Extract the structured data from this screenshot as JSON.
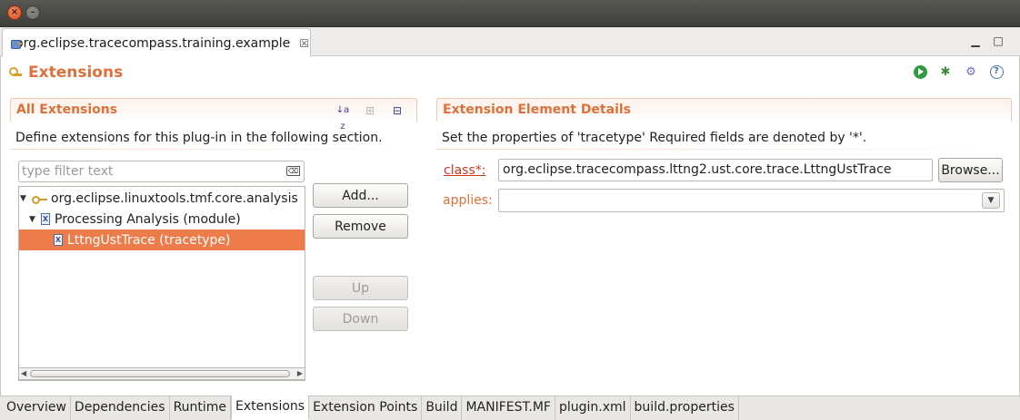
{
  "window": {
    "close_glyph": "×",
    "minimize_glyph": "–"
  },
  "editor_tab": {
    "title": "org.eclipse.tracecompass.training.example",
    "close_glyph": "☒",
    "minimize_glyph": "▁",
    "maximize_glyph": "□"
  },
  "page": {
    "title": "Extensions",
    "toolbar": {
      "run": "run-icon",
      "debug": "bug-icon",
      "manage": "plugin-settings-icon",
      "help_glyph": "?"
    }
  },
  "all_extensions": {
    "title": "All Extensions",
    "description": "Define extensions for this plug-in in the following section.",
    "filter_placeholder": "type filter text",
    "clear_glyph": "⌫",
    "tree": [
      {
        "label": "org.eclipse.linuxtools.tmf.core.analysis",
        "level": 0,
        "expanded": true,
        "icon": "key-icon"
      },
      {
        "label": "Processing Analysis (module)",
        "level": 1,
        "expanded": true,
        "icon": "x-icon"
      },
      {
        "label": "LttngUstTrace (tracetype)",
        "level": 2,
        "selected": true,
        "icon": "x-icon"
      }
    ],
    "buttons": {
      "add": "Add...",
      "remove": "Remove",
      "up": "Up",
      "down": "Down"
    },
    "sort_glyph": "↓a z",
    "expand_glyph": "⊞",
    "collapse_glyph": "⊟"
  },
  "details": {
    "title": "Extension Element Details",
    "description": "Set the properties of 'tracetype' Required fields are denoted by '*'.",
    "class_label": "class*:",
    "class_value": "org.eclipse.tracecompass.lttng2.ust.core.trace.LttngUstTrace",
    "browse": "Browse...",
    "applies_label": "applies:",
    "applies_value": "",
    "combo_glyph": "▼"
  },
  "bottom_tabs": [
    "Overview",
    "Dependencies",
    "Runtime",
    "Extensions",
    "Extension Points",
    "Build",
    "MANIFEST.MF",
    "plugin.xml",
    "build.properties"
  ],
  "active_bottom_tab": "Extensions",
  "colors": {
    "accent": "#e0703a",
    "selection": "#ee7c4b",
    "link": "#c8361c"
  }
}
